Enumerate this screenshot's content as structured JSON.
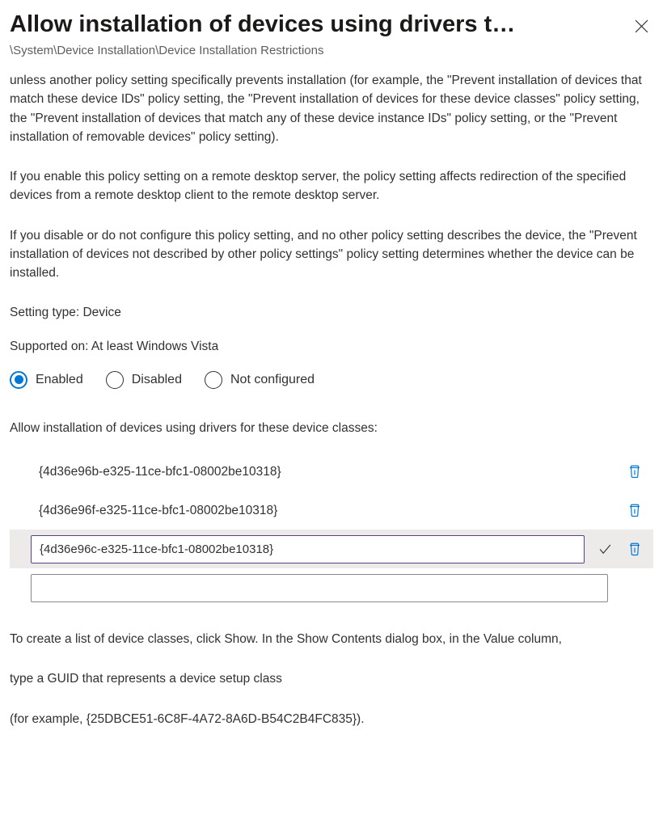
{
  "header": {
    "title": "Allow installation of devices using drivers t…",
    "breadcrumb": "\\System\\Device Installation\\Device Installation Restrictions"
  },
  "body": {
    "para1": "unless another policy setting specifically prevents installation (for example, the \"Prevent installation of devices that match these device IDs\" policy setting, the \"Prevent installation of devices for these device classes\" policy setting, the \"Prevent installation of devices that match any of these device instance IDs\" policy setting, or the \"Prevent installation of removable devices\" policy setting).",
    "para2": "If you enable this policy setting on a remote desktop server, the policy setting affects redirection of the specified devices from a remote desktop client to the remote desktop server.",
    "para3": "If you disable or do not configure this policy setting, and no other policy setting describes the device, the \"Prevent installation of devices not described by other policy settings\" policy setting determines whether the device can be installed."
  },
  "meta": {
    "setting_type_label": "Setting type: Device",
    "supported_on_label": "Supported on: At least Windows Vista"
  },
  "state": {
    "options": {
      "enabled": "Enabled",
      "disabled": "Disabled",
      "not_configured": "Not configured"
    },
    "selected": "enabled"
  },
  "list": {
    "label": "Allow installation of devices using drivers for these device classes:",
    "items": [
      "{4d36e96b-e325-11ce-bfc1-08002be10318}",
      "{4d36e96f-e325-11ce-bfc1-08002be10318}"
    ],
    "editing_value": "{4d36e96c-e325-11ce-bfc1-08002be10318}",
    "new_value": ""
  },
  "footer": {
    "para1": "To create a list of device classes, click Show. In the Show Contents dialog box, in the Value column,",
    "para2": "type a GUID that represents a device setup class",
    "para3": "(for example, {25DBCE51-6C8F-4A72-8A6D-B54C2B4FC835})."
  }
}
